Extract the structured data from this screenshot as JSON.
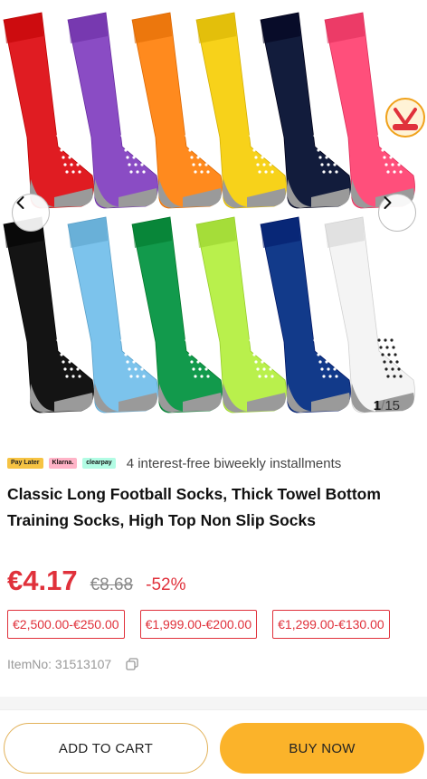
{
  "gallery": {
    "current": "1",
    "separator": "/",
    "total": "15",
    "sock_colors_top": [
      "#e01c22",
      "#8a4cc4",
      "#ff8a1e",
      "#f7d21a",
      "#121c3c",
      "#ff4f7b"
    ],
    "sock_colors_bottom": [
      "#141414",
      "#7cc3ec",
      "#129a4c",
      "#b9f04c",
      "#123a8a",
      "#f4f4f4"
    ],
    "prev_icon": "chevron-left-icon",
    "next_icon": "chevron-right-icon",
    "badge_icon": "vip-badge-icon"
  },
  "payment": {
    "logos": [
      "Pay Later",
      "Klarna.",
      "clearpay"
    ],
    "text": "4 interest-free biweekly installments"
  },
  "product": {
    "title": "Classic Long Football Socks, Thick Towel Bottom Training Socks, High Top Non Slip Socks",
    "price_now": "€4.17",
    "price_old": "€8.68",
    "discount": "-52%",
    "tiers": [
      "€2,500.00-€250.00",
      "€1,999.00-€200.00",
      "€1,299.00-€130.00"
    ],
    "item_no": "ItemNo: 31513107",
    "copy_icon": "copy-icon"
  },
  "actions": {
    "add_to_cart": "ADD TO CART",
    "buy_now": "BUY NOW"
  },
  "colors": {
    "accent_red": "#e0313b",
    "buy_button": "#fbb32a",
    "cart_border": "#e2b25a"
  }
}
